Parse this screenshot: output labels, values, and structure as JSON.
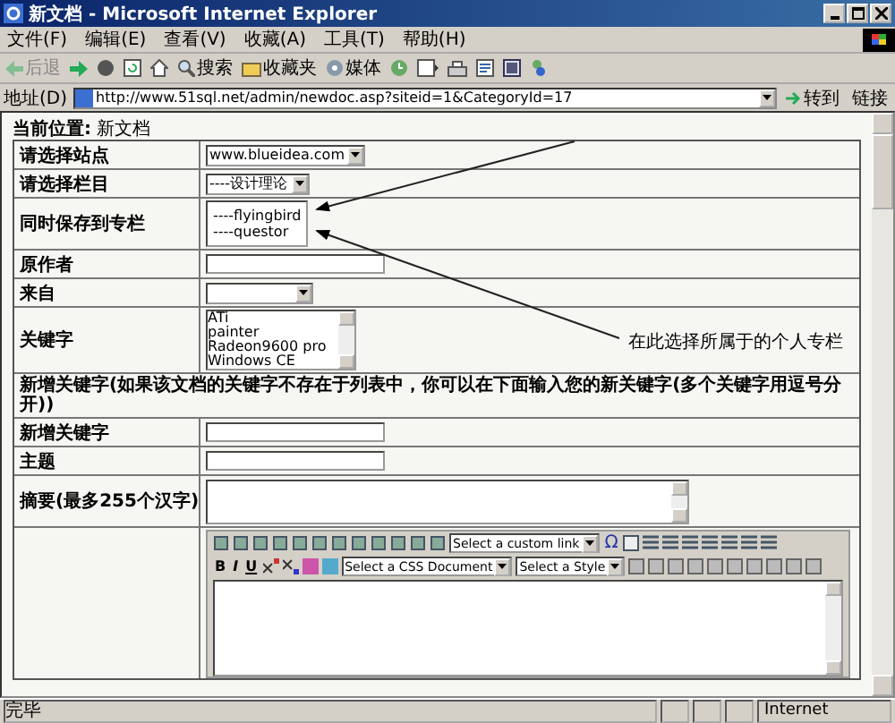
{
  "window": {
    "title": "新文档 - Microsoft Internet Explorer"
  },
  "menu": [
    "文件(F)",
    "编辑(E)",
    "查看(V)",
    "收藏(A)",
    "工具(T)",
    "帮助(H)"
  ],
  "toolbar": [
    {
      "kind": "back",
      "label": "后退",
      "disabled": true
    },
    {
      "kind": "forward",
      "disabled": false
    },
    {
      "kind": "stop",
      "disabled": false
    },
    {
      "kind": "refresh",
      "disabled": false
    },
    {
      "kind": "home",
      "disabled": false
    },
    {
      "kind": "search",
      "label": "搜索",
      "disabled": false
    },
    {
      "kind": "favorites",
      "label": "收藏夹",
      "disabled": false
    },
    {
      "kind": "media",
      "label": "媒体",
      "disabled": false
    },
    {
      "kind": "history",
      "disabled": false
    },
    {
      "kind": "mail",
      "disabled": false
    },
    {
      "kind": "print",
      "disabled": false
    },
    {
      "kind": "edit",
      "disabled": false
    },
    {
      "kind": "discuss",
      "disabled": false
    },
    {
      "kind": "messenger",
      "disabled": false
    }
  ],
  "address": {
    "label": "地址(D)",
    "url": "http://www.51sql.net/admin/newdoc.asp?siteid=1&CategoryId=17",
    "go": "转到",
    "links": "链接"
  },
  "breadcrumb": {
    "label": "当前位置:",
    "value": "新文档"
  },
  "form": [
    {
      "kind": "select",
      "label": "请选择站点",
      "value": "www.blueidea.com"
    },
    {
      "kind": "select",
      "label": "请选择栏目",
      "value": "----设计理论"
    },
    {
      "kind": "list",
      "label": "同时保存到专栏",
      "options": [
        "----flyingbird",
        "----questor"
      ]
    },
    {
      "kind": "input",
      "label": "原作者"
    },
    {
      "kind": "select",
      "label": "来自"
    },
    {
      "kind": "multiselect",
      "label": "关键字",
      "options": [
        "ATi",
        "painter",
        "Radeon9600 pro",
        "Windows CE"
      ]
    },
    {
      "kind": "notice",
      "label": "新增关键字(如果该文档的关键字不存在于列表中，你可以在下面输入您的新关键字(多个关键字用逗号分开))"
    },
    {
      "kind": "input",
      "label": "新增关键字"
    },
    {
      "kind": "input",
      "label": "主题"
    },
    {
      "kind": "textarea",
      "label": "摘要(最多255个汉字)"
    },
    {
      "kind": "editor"
    }
  ],
  "editor": {
    "custom_link": "Select a custom link",
    "omega": "Ω",
    "bold": "B",
    "italic": "I",
    "underline": "U",
    "css": "Select a CSS Document",
    "style": "Select a Style"
  },
  "annotation": "在此选择所属于的个人专栏",
  "status_bar": {
    "text": "完毕",
    "zone": "Internet"
  }
}
